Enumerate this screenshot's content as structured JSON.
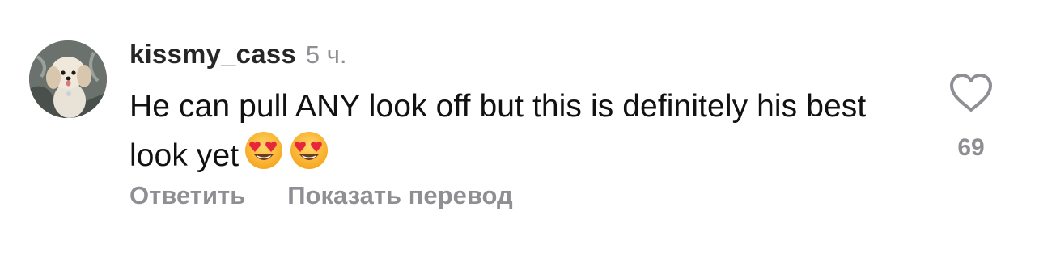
{
  "comment": {
    "username": "kissmy_cass",
    "timestamp": "5 ч.",
    "text": "He can pull ANY look off but this is definitely his best look yet",
    "emojis": [
      "heart-eyes-emoji",
      "heart-eyes-emoji"
    ],
    "like_count": "69",
    "actions": {
      "reply_label": "Ответить",
      "translate_label": "Показать перевод"
    }
  },
  "icons": {
    "like": "heart-outline-icon",
    "avatar": "user-avatar-dog-photo"
  },
  "colors": {
    "primary_text": "#111111",
    "secondary_text": "#8e8e93",
    "background": "#ffffff"
  }
}
